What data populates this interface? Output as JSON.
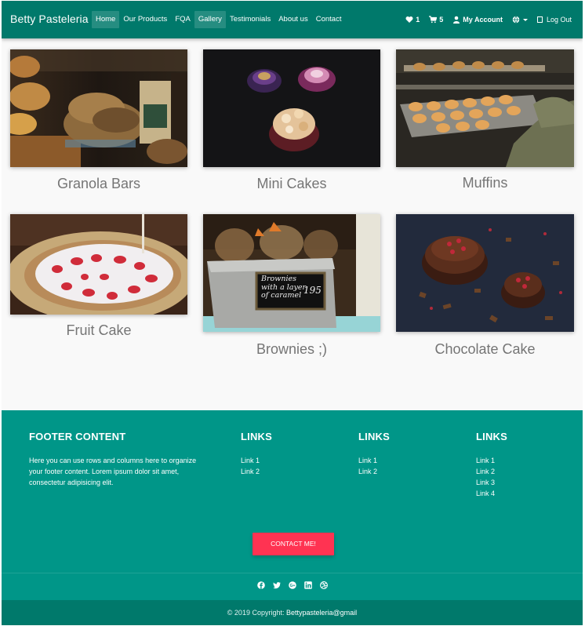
{
  "navbar": {
    "brand": "Betty Pasteleria",
    "links": [
      "Home",
      "Our Products",
      "FQA",
      "Gallery",
      "Testimonials",
      "About us",
      "Contact"
    ],
    "wishlist_count": "1",
    "cart_count": "5",
    "account_label": "My Account",
    "logout_label": "Log Out",
    "primary_color": "#00796b"
  },
  "gallery": {
    "items": [
      {
        "caption": "Granola Bars",
        "image": "granola-bars-photo"
      },
      {
        "caption": "Mini Cakes",
        "image": "mini-cakes-photo"
      },
      {
        "caption": "Muffins",
        "image": "muffins-photo"
      },
      {
        "caption": "Fruit Cake",
        "image": "fruit-cake-photo"
      },
      {
        "caption": "Brownies ;)",
        "image": "brownies-photo",
        "sign_text": [
          "Brownies",
          "with a layer",
          "of caramel"
        ],
        "price": "195"
      },
      {
        "caption": "Chocolate Cake",
        "image": "chocolate-cake-photo"
      }
    ]
  },
  "footer": {
    "heading": "FOOTER CONTENT",
    "text": "Here you can use rows and columns here to organize your footer content. Lorem ipsum dolor sit amet, consectetur adipisicing elit.",
    "columns": [
      {
        "title": "LINKS",
        "links": [
          "Link 1",
          "Link 2"
        ]
      },
      {
        "title": "LINKS",
        "links": [
          "Link 1",
          "Link 2"
        ]
      },
      {
        "title": "LINKS",
        "links": [
          "Link 1",
          "Link 2",
          "Link 3",
          "Link 4"
        ]
      }
    ],
    "contact_button": "CONTACT ME!",
    "social_icons": [
      "facebook-icon",
      "twitter-icon",
      "google-plus-icon",
      "linkedin-icon",
      "dribbble-icon"
    ],
    "copyright_prefix": "© 2019 Copyright:",
    "copyright_link": "Bettypasteleria@gmail",
    "bg_color": "#009688",
    "button_color": "#ff3352"
  }
}
